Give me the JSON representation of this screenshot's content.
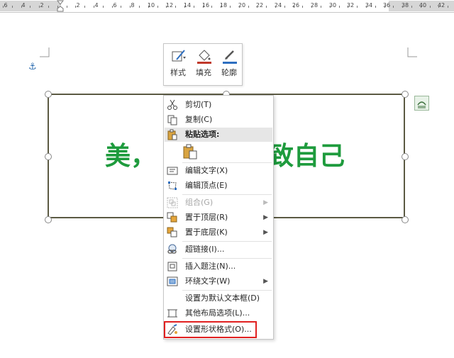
{
  "ruler": {
    "labels": [
      "6",
      "4",
      "2",
      "2",
      "4",
      "6",
      "8",
      "10",
      "12",
      "14",
      "16",
      "18",
      "20",
      "22",
      "24",
      "26",
      "28",
      "30",
      "32",
      "34",
      "36",
      "38",
      "40",
      "42"
    ]
  },
  "textbox": {
    "text_left": "美，",
    "text_right": "致自己"
  },
  "mini_toolbar": {
    "style_label": "样式",
    "fill_label": "填充",
    "outline_label": "轮廓",
    "fill_color": "#c0392b",
    "outline_color": "#2e6fc0"
  },
  "menu": {
    "cut": "剪切(T)",
    "copy": "复制(C)",
    "paste_options": "粘贴选项:",
    "edit_text": "编辑文字(X)",
    "edit_points": "编辑顶点(E)",
    "group": "组合(G)",
    "bring_to_front": "置于顶层(R)",
    "send_to_back": "置于底层(K)",
    "hyperlink": "超链接(I)...",
    "insert_caption": "插入题注(N)...",
    "wrap_text": "环绕文字(W)",
    "set_default_textbox": "设置为默认文本框(D)",
    "more_layout": "其他布局选项(L)...",
    "format_shape": "设置形状格式(O)..."
  },
  "colors": {
    "text_green": "#1e9b3d",
    "highlight_red": "#e02020",
    "border": "#5b5a43"
  }
}
